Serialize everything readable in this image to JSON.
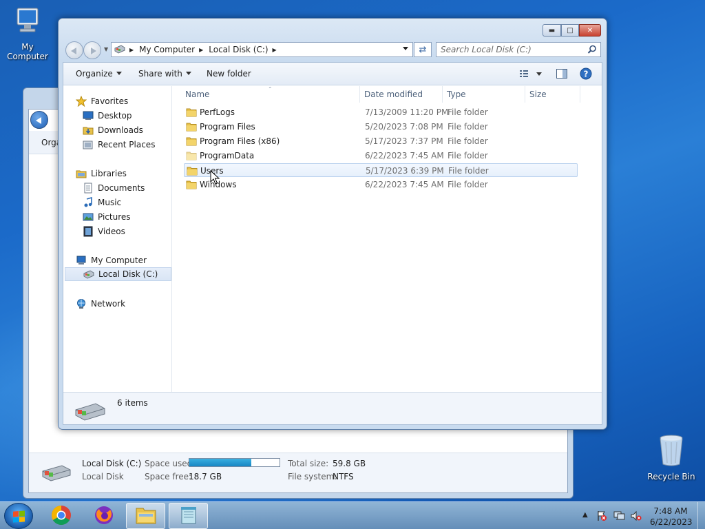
{
  "desktop": {
    "icons": {
      "my_computer": "My Computer",
      "recycle_bin": "Recycle Bin"
    }
  },
  "background_window": {
    "toolbar_partial": "Orga",
    "status": {
      "drive_name": "Local Disk (C:)",
      "drive_type": "Local Disk",
      "space_used_label": "Space used:",
      "space_used_fraction": 0.69,
      "space_free_label": "Space free:",
      "space_free_value": "18.7 GB",
      "total_size_label": "Total size:",
      "total_size_value": "59.8 GB",
      "file_system_label": "File system:",
      "file_system_value": "NTFS"
    }
  },
  "explorer": {
    "address": {
      "crumbs": [
        "My Computer",
        "Local Disk (C:)"
      ]
    },
    "search": {
      "placeholder": "Search Local Disk (C:)"
    },
    "toolbar": {
      "organize": "Organize",
      "share_with": "Share with",
      "new_folder": "New folder"
    },
    "nav": {
      "favorites": "Favorites",
      "desktop": "Desktop",
      "downloads": "Downloads",
      "recent_places": "Recent Places",
      "libraries": "Libraries",
      "documents": "Documents",
      "music": "Music",
      "pictures": "Pictures",
      "videos": "Videos",
      "my_computer": "My Computer",
      "local_disk": "Local Disk (C:)",
      "network": "Network"
    },
    "columns": {
      "name": "Name",
      "date_modified": "Date modified",
      "type": "Type",
      "size": "Size"
    },
    "files": [
      {
        "name": "PerfLogs",
        "date": "7/13/2009 11:20 PM",
        "type": "File folder"
      },
      {
        "name": "Program Files",
        "date": "5/20/2023 7:08 PM",
        "type": "File folder"
      },
      {
        "name": "Program Files (x86)",
        "date": "5/17/2023 7:37 PM",
        "type": "File folder"
      },
      {
        "name": "ProgramData",
        "date": "6/22/2023 7:45 AM",
        "type": "File folder"
      },
      {
        "name": "Users",
        "date": "5/17/2023 6:39 PM",
        "type": "File folder"
      },
      {
        "name": "Windows",
        "date": "6/22/2023 7:45 AM",
        "type": "File folder"
      }
    ],
    "details": {
      "item_count": "6 items"
    }
  },
  "taskbar": {
    "time": "7:48 AM",
    "date": "6/22/2023"
  },
  "colors": {
    "desktop_blue": "#1b6ac9",
    "folder_yellow": "#e8c24a",
    "selection_blue": "#cfe0f6"
  }
}
